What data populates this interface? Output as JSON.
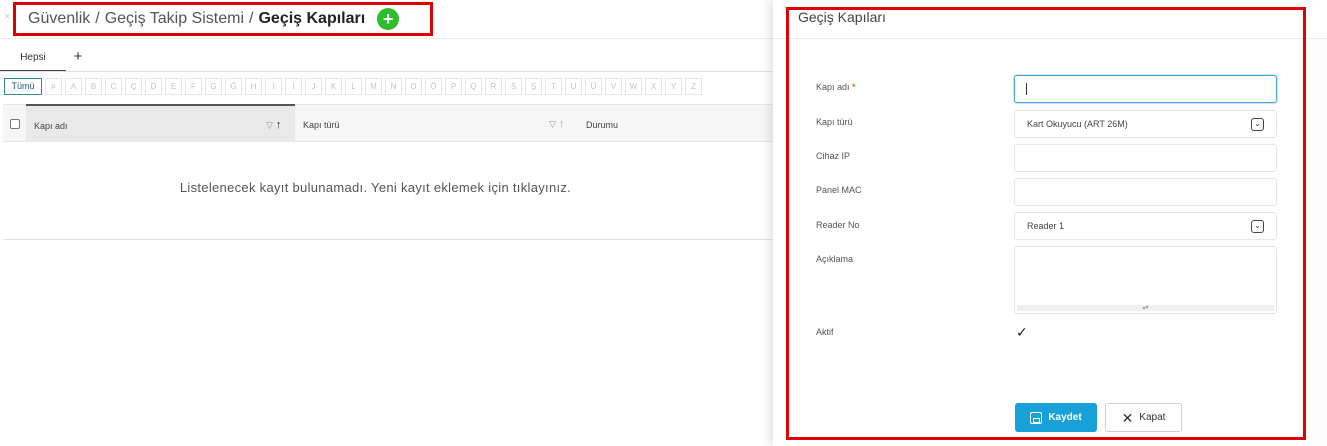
{
  "breadcrumb": {
    "items": [
      "Güvenlik",
      "Geçiş Takip Sistemi"
    ],
    "separator": "/",
    "current": "Geçiş Kapıları",
    "add_icon": "+"
  },
  "close_icon": "×",
  "tabs": {
    "items": [
      "Hepsi"
    ],
    "add_label": "+"
  },
  "letter_filter": {
    "all_label": "Tümü",
    "letters": [
      "#",
      "A",
      "B",
      "C",
      "Ç",
      "D",
      "E",
      "F",
      "G",
      "Ğ",
      "H",
      "I",
      "İ",
      "J",
      "K",
      "L",
      "M",
      "N",
      "O",
      "Ö",
      "P",
      "Q",
      "R",
      "S",
      "Ş",
      "T",
      "U",
      "Ü",
      "V",
      "W",
      "X",
      "Y",
      "Z"
    ]
  },
  "grid": {
    "columns": [
      {
        "label": "Kapı adı",
        "filter_icon": "▽",
        "sort_icon": "↑"
      },
      {
        "label": "Kapı türü",
        "filter_icon": "▽",
        "sort_icon": "↑"
      },
      {
        "label": "Durumu"
      }
    ],
    "empty_message": "Listelenecek kayıt bulunamadı. Yeni kayıt eklemek için tıklayınız."
  },
  "modal": {
    "title": "Geçiş Kapıları",
    "fields": {
      "name": {
        "label": "Kapı adı",
        "required_mark": "*",
        "value": ""
      },
      "type": {
        "label": "Kapı türü",
        "value": "Kart Okuyucu (ART 26M)",
        "dropdown_icon": "⌄"
      },
      "ip": {
        "label": "Cihaz IP",
        "value": ""
      },
      "mac": {
        "label": "Panel MAC",
        "value": ""
      },
      "reader": {
        "label": "Reader No",
        "value": "Reader 1",
        "dropdown_icon": "⌄"
      },
      "description": {
        "label": "Açıklama",
        "value": "",
        "resize_icon": "▴▾"
      },
      "active": {
        "label": "Aktif",
        "checked": true,
        "check_icon": "✓"
      }
    },
    "buttons": {
      "save": "Kaydet",
      "close": "Kapat",
      "close_icon": "✕"
    }
  },
  "colors": {
    "highlight_border": "#e00000",
    "add_button": "#2dbe2d",
    "save_button": "#18a0d8",
    "focus_border": "#4aa3df"
  }
}
